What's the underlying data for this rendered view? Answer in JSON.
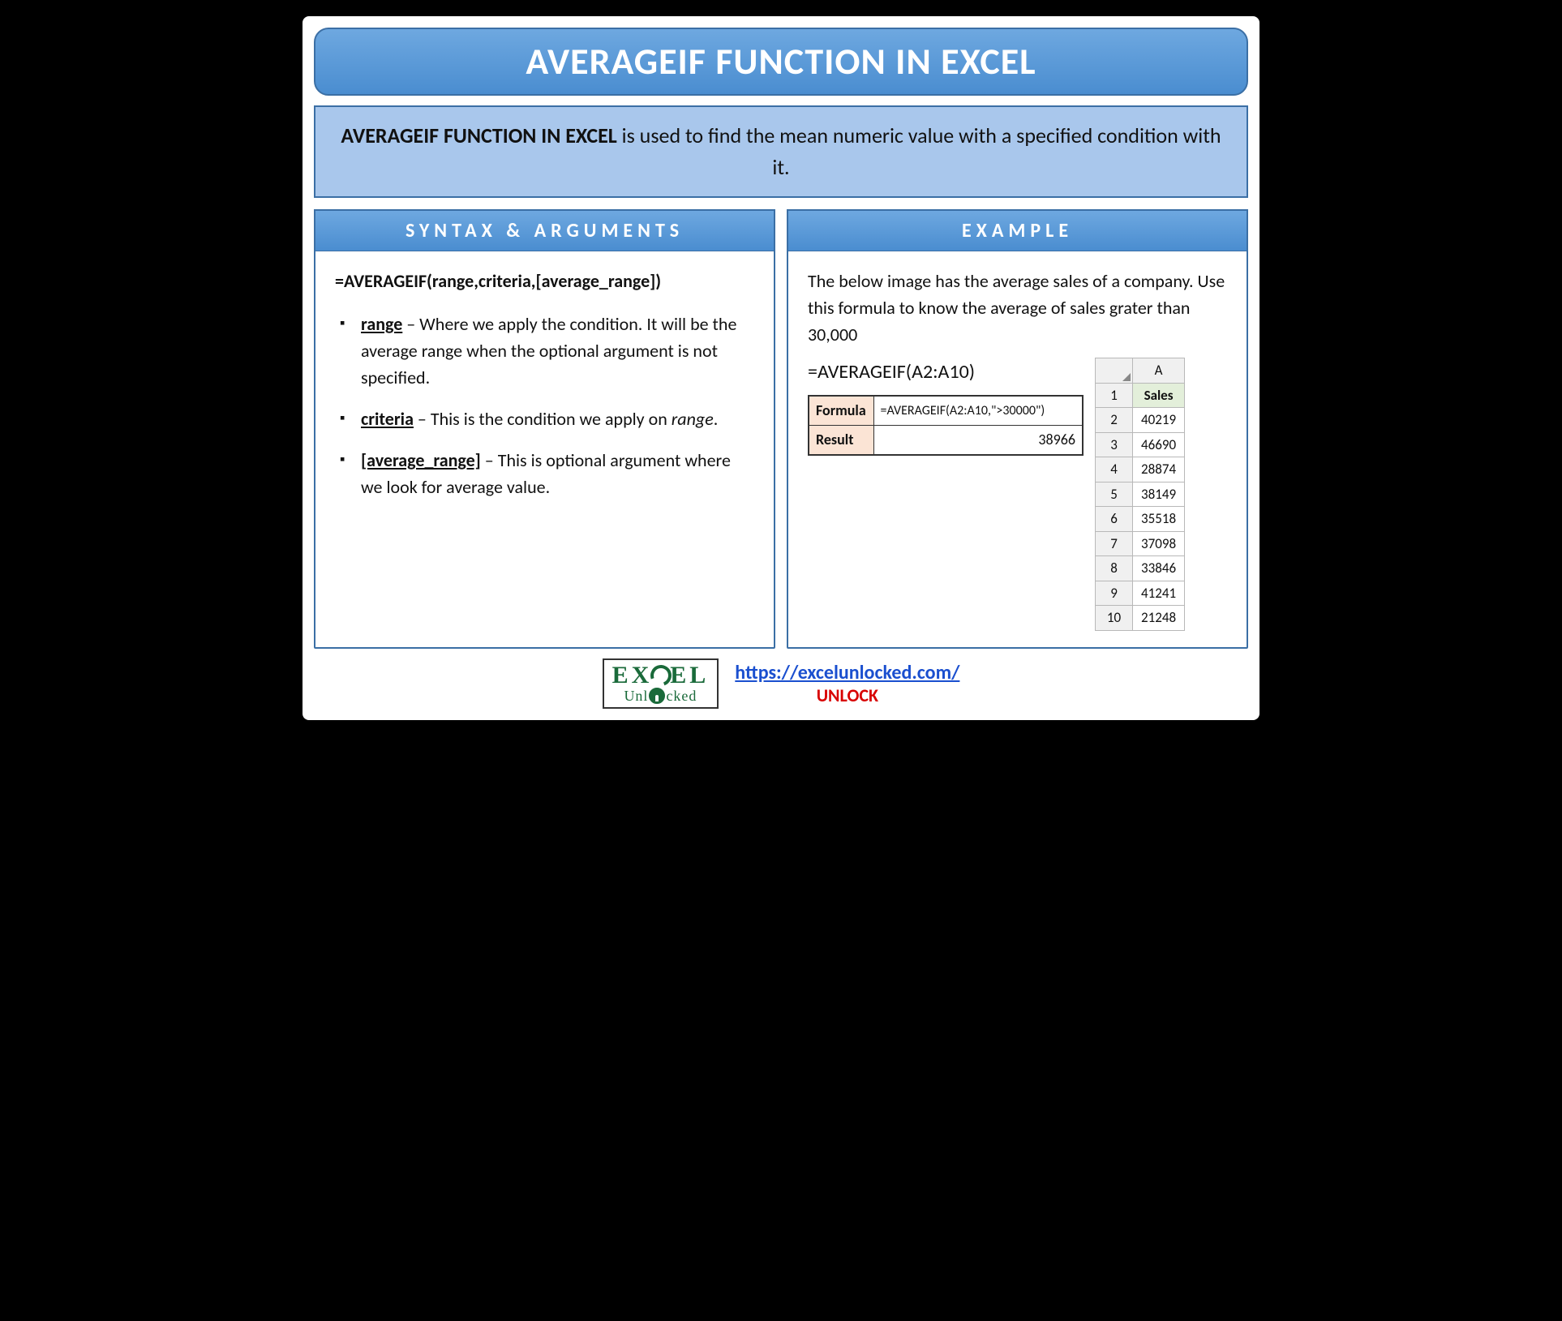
{
  "title": "AVERAGEIF FUNCTION IN EXCEL",
  "description": {
    "bold": "AVERAGEIF FUNCTION IN EXCEL",
    "rest": " is used to find the mean numeric value with a specified condition with it."
  },
  "syntax": {
    "heading": "SYNTAX & ARGUMENTS",
    "formula": "=AVERAGEIF(range,criteria,[average_range])",
    "args": [
      {
        "name": "range",
        "text": " – Where we apply the condition. It will be the average range when the optional argument is not specified."
      },
      {
        "name": "criteria",
        "text_pre": " – This is the condition we apply on ",
        "ital": "range",
        "text_post": "."
      },
      {
        "name": "[average_range]",
        "text": " – This is optional argument where we look for average value."
      }
    ]
  },
  "example": {
    "heading": "EXAMPLE",
    "intro": "The below image has the average sales of a company. Use this formula to know the average of sales grater than 30,000",
    "inline_formula": "=AVERAGEIF(A2:A10)",
    "table": {
      "row1_label": "Formula",
      "row1_value": "=AVERAGEIF(A2:A10,\">30000\")",
      "row2_label": "Result",
      "row2_value": "38966"
    },
    "sheet": {
      "col": "A",
      "header": "Sales",
      "rows": [
        {
          "n": "1",
          "v": "Sales"
        },
        {
          "n": "2",
          "v": "40219"
        },
        {
          "n": "3",
          "v": "46690"
        },
        {
          "n": "4",
          "v": "28874"
        },
        {
          "n": "5",
          "v": "38149"
        },
        {
          "n": "6",
          "v": "35518"
        },
        {
          "n": "7",
          "v": "37098"
        },
        {
          "n": "8",
          "v": "33846"
        },
        {
          "n": "9",
          "v": "41241"
        },
        {
          "n": "10",
          "v": "21248"
        }
      ]
    }
  },
  "footer": {
    "logo_top_pre": "EX",
    "logo_top_post": "EL",
    "logo_bot_pre": "Unl",
    "logo_bot_post": "cked",
    "link": "https://excelunlocked.com/",
    "unlock": "UNLOCK"
  }
}
